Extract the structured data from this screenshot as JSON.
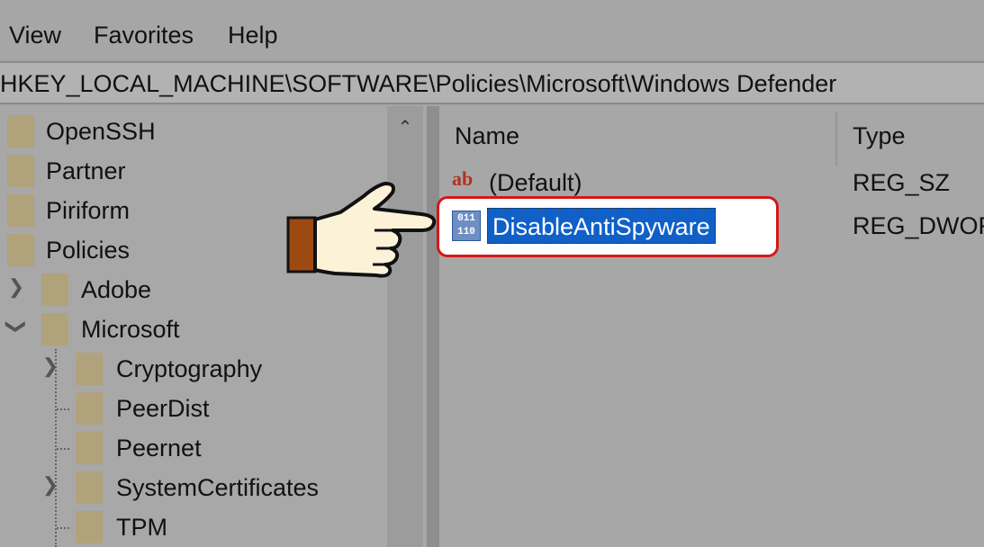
{
  "menu": {
    "view": "View",
    "favorites": "Favorites",
    "help": "Help"
  },
  "address": {
    "path": "HKEY_LOCAL_MACHINE\\SOFTWARE\\Policies\\Microsoft\\Windows Defender"
  },
  "tree": {
    "items": [
      {
        "label": "OpenSSH"
      },
      {
        "label": "Partner"
      },
      {
        "label": "Piriform"
      },
      {
        "label": "Policies"
      },
      {
        "label": "Adobe"
      },
      {
        "label": "Microsoft"
      },
      {
        "label": "Cryptography"
      },
      {
        "label": "PeerDist"
      },
      {
        "label": "Peernet"
      },
      {
        "label": "SystemCertificates"
      },
      {
        "label": "TPM"
      }
    ]
  },
  "list": {
    "columns": {
      "name": "Name",
      "type": "Type"
    },
    "rows": [
      {
        "name": "(Default)",
        "type": "REG_SZ",
        "icon": "string-value-icon"
      },
      {
        "name": "DisableAntiSpyware",
        "type": "REG_DWOR",
        "icon": "binary-value-icon"
      }
    ]
  },
  "icons": {
    "ab_text": "ab",
    "bin_text": "011\n110"
  },
  "colors": {
    "highlight_border": "#d41818",
    "selection": "#1060c8",
    "hand_cuff": "#9c4a12"
  }
}
